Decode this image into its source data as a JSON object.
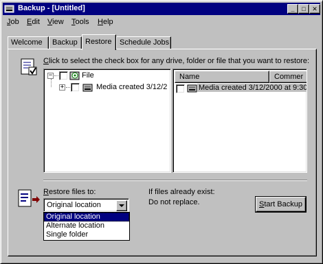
{
  "window": {
    "title": "Backup - [Untitled]",
    "controls": {
      "minimize": "_",
      "maximize": "□",
      "close": "✕"
    }
  },
  "menu": [
    {
      "label": "Job",
      "key": "J",
      "rest": "ob"
    },
    {
      "label": "Edit",
      "key": "E",
      "rest": "dit"
    },
    {
      "label": "View",
      "key": "V",
      "rest": "iew"
    },
    {
      "label": "Tools",
      "key": "T",
      "rest": "ools"
    },
    {
      "label": "Help",
      "key": "H",
      "rest": "elp"
    }
  ],
  "tabs": [
    "Welcome",
    "Backup",
    "Restore",
    "Schedule Jobs"
  ],
  "active_tab": "Restore",
  "instruction": {
    "key": "C",
    "rest": "lick to select the check box for any drive, folder or file that you want to restore:"
  },
  "tree": {
    "root": "File",
    "child": "Media created 3/12/2"
  },
  "list": {
    "columns": [
      "Name",
      "Commer"
    ],
    "rows": [
      {
        "name": "Media created 3/12/2000 at 9:30"
      }
    ]
  },
  "restore": {
    "label_key": "R",
    "label_rest": "estore files to:",
    "selected": "Original location",
    "options": [
      "Original location",
      "Alternate location",
      "Single folder"
    ]
  },
  "existing": {
    "line1": "If files already exist:",
    "line2": "Do not replace."
  },
  "start_button": {
    "key": "S",
    "rest": "tart Backup"
  },
  "colors": {
    "titlebar": "#000080",
    "face": "#c0c0c0",
    "selection": "#000080"
  }
}
